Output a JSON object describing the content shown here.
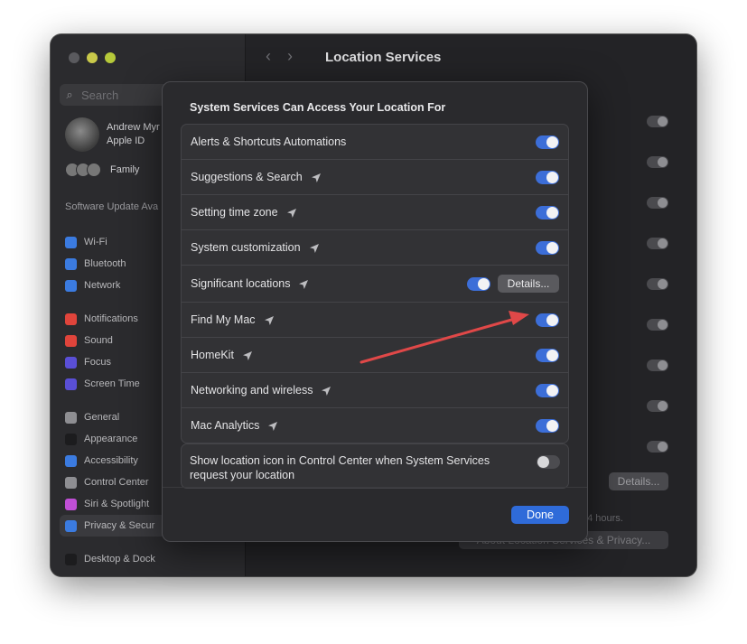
{
  "sidebar": {
    "search_placeholder": "Search",
    "account": {
      "name": "Andrew Myr",
      "sub": "Apple ID"
    },
    "family": "Family",
    "software_update": "Software Update Ava",
    "groups": [
      [
        {
          "label": "Wi-Fi",
          "icon": "wifi-icon",
          "color": "#3b7be0"
        },
        {
          "label": "Bluetooth",
          "icon": "bluetooth-icon",
          "color": "#3b7be0"
        },
        {
          "label": "Network",
          "icon": "network-icon",
          "color": "#3b7be0"
        }
      ],
      [
        {
          "label": "Notifications",
          "icon": "notifications-icon",
          "color": "#e0443b"
        },
        {
          "label": "Sound",
          "icon": "sound-icon",
          "color": "#e0443b"
        },
        {
          "label": "Focus",
          "icon": "focus-icon",
          "color": "#5a4fd6"
        },
        {
          "label": "Screen Time",
          "icon": "screen-time-icon",
          "color": "#5a4fd6"
        }
      ],
      [
        {
          "label": "General",
          "icon": "general-icon",
          "color": "#8e8e92"
        },
        {
          "label": "Appearance",
          "icon": "appearance-icon",
          "color": "#1c1c1e"
        },
        {
          "label": "Accessibility",
          "icon": "accessibility-icon",
          "color": "#3b7be0"
        },
        {
          "label": "Control Center",
          "icon": "control-center-icon",
          "color": "#8e8e92"
        },
        {
          "label": "Siri & Spotlight",
          "icon": "siri-icon",
          "color": "#c04fd6"
        },
        {
          "label": "Privacy & Secur",
          "icon": "privacy-icon",
          "color": "#3b7be0",
          "selected": true
        }
      ],
      [
        {
          "label": "Desktop & Dock",
          "icon": "desktop-dock-icon",
          "color": "#1c1c1e"
        }
      ]
    ]
  },
  "header": {
    "title": "Location Services"
  },
  "background": {
    "details_label": "Details...",
    "hours_text": "24 hours.",
    "about_label": "About Location Services & Privacy..."
  },
  "sheet": {
    "title": "System Services Can Access Your Location For",
    "rows": [
      {
        "label": "Alerts & Shortcuts Automations",
        "arrow": false,
        "on": true
      },
      {
        "label": "Suggestions & Search",
        "arrow": true,
        "on": true
      },
      {
        "label": "Setting time zone",
        "arrow": true,
        "on": true
      },
      {
        "label": "System customization",
        "arrow": true,
        "on": true
      },
      {
        "label": "Significant locations",
        "arrow": true,
        "on": true,
        "details": "Details..."
      },
      {
        "label": "Find My Mac",
        "arrow": true,
        "on": true
      },
      {
        "label": "HomeKit",
        "arrow": true,
        "on": true
      },
      {
        "label": "Networking and wireless",
        "arrow": true,
        "on": true
      },
      {
        "label": "Mac Analytics",
        "arrow": true,
        "on": true
      }
    ],
    "show_icon_label": "Show location icon in Control Center when System Services request your location",
    "show_icon_on": false,
    "done_label": "Done"
  },
  "colors": {
    "accent": "#3c6ed8",
    "annotation": "#e04848"
  }
}
